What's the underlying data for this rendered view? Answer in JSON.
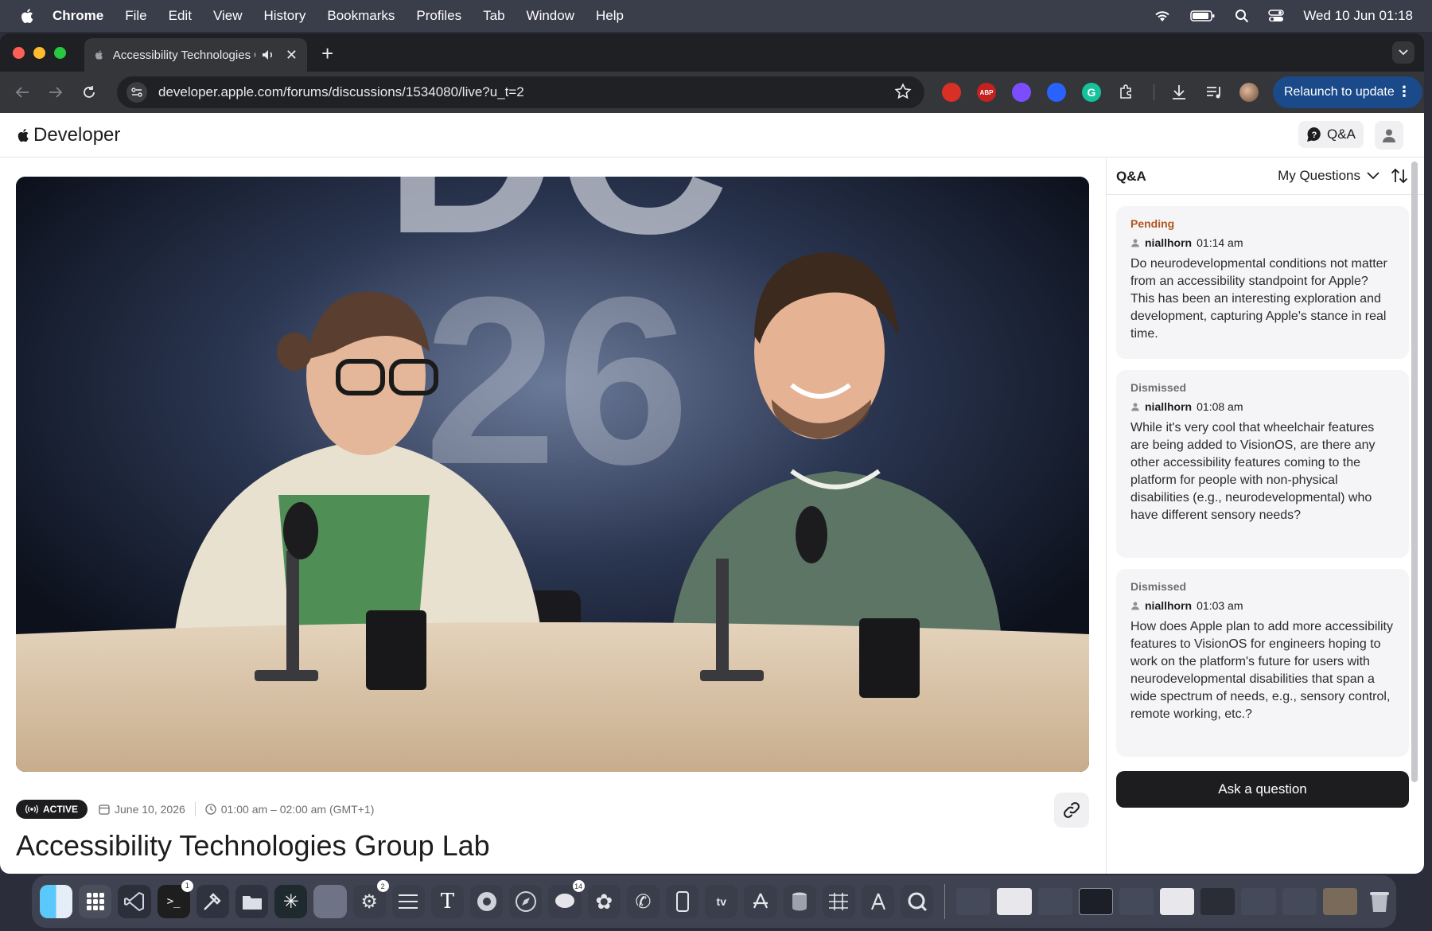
{
  "menubar": {
    "app": "Chrome",
    "items": [
      "File",
      "Edit",
      "View",
      "History",
      "Bookmarks",
      "Profiles",
      "Tab",
      "Window",
      "Help"
    ],
    "clock": "Wed 10 Jun  01:18"
  },
  "browser": {
    "tab_title": "Accessibility Technologies Group Lab",
    "url": "developer.apple.com/forums/discussions/1534080/live?u_t=2",
    "relaunch_label": "Relaunch to update",
    "extension_abp": "ABP"
  },
  "header": {
    "logo_text": "Developer",
    "qa_label": "Q&A"
  },
  "session": {
    "status": "ACTIVE",
    "date": "June 10, 2026",
    "time": "01:00 am – 02:00 am (GMT+1)",
    "title": "Accessibility Technologies Group Lab",
    "backdrop_text_top": "DC",
    "backdrop_text_bottom": "26"
  },
  "qa": {
    "title": "Q&A",
    "filter": "My Questions",
    "ask_label": "Ask a question",
    "questions": [
      {
        "status": "Pending",
        "user": "niallhorn",
        "time": "01:14 am",
        "text": "Do neurodevelopmental conditions not matter from an accessibility standpoint for Apple? This has been an interesting exploration and development, capturing Apple's stance in real time."
      },
      {
        "status": "Dismissed",
        "user": "niallhorn",
        "time": "01:08 am",
        "text": "While it's very cool that wheelchair features are being added to VisionOS, are there any other accessibility features coming to the platform for people with non-physical disabilities (e.g., neurodevelopmental) who have different sensory needs?"
      },
      {
        "status": "Dismissed",
        "user": "niallhorn",
        "time": "01:03 am",
        "text": "How does Apple plan to add more accessibility features to VisionOS for engineers hoping to work on the platform's future for users with neurodevelopmental disabilities that span a wide spectrum of needs, e.g., sensory control, remote working, etc.?"
      }
    ]
  },
  "dock": {
    "badges": [
      "1",
      "2",
      "14"
    ]
  },
  "colors": {
    "pending": "#b4561d",
    "relaunch": "#1a4a8a",
    "ask_button": "#1d1d1f"
  }
}
